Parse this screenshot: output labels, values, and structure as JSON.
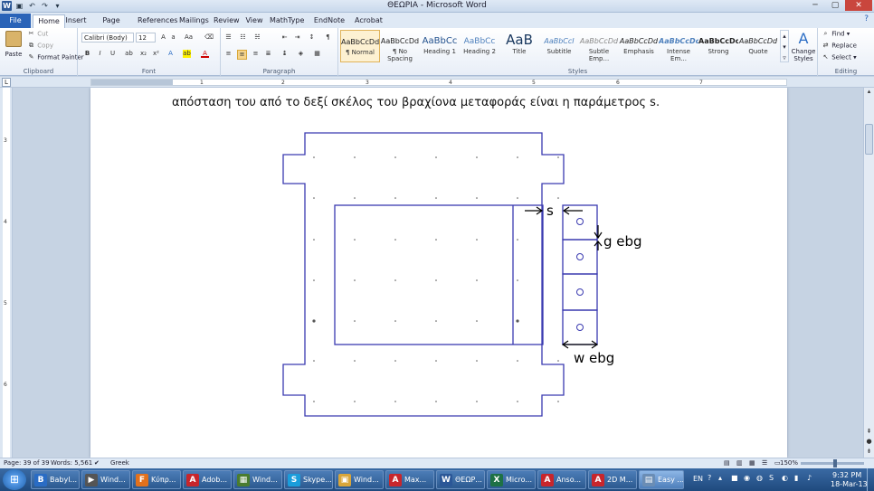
{
  "window": {
    "title": "ΘΕΩΡΙΑ - Microsoft Word",
    "minimize": "─",
    "maximize": "▢",
    "close": "✕"
  },
  "tabs": [
    "File",
    "Home",
    "Insert",
    "Page Layout",
    "References",
    "Mailings",
    "Review",
    "View",
    "MathType",
    "EndNote X5",
    "Acrobat"
  ],
  "ribbon": {
    "clipboard": {
      "paste": "Paste",
      "cut": "Cut",
      "copy": "Copy",
      "format_painter": "Format Painter",
      "label": "Clipboard"
    },
    "font": {
      "name": "Calibri (Body)",
      "size": "12",
      "label": "Font"
    },
    "paragraph": {
      "label": "Paragraph"
    },
    "styles": {
      "label": "Styles",
      "items": [
        {
          "sample": "AaBbCcDd",
          "name": "¶ Normal"
        },
        {
          "sample": "AaBbCcDd",
          "name": "¶ No Spacing"
        },
        {
          "sample": "AaBbCc",
          "name": "Heading 1"
        },
        {
          "sample": "AaBbCc",
          "name": "Heading 2"
        },
        {
          "sample": "AaB",
          "name": "Title"
        },
        {
          "sample": "AaBbCcI",
          "name": "Subtitle"
        },
        {
          "sample": "AaBbCcDd",
          "name": "Subtle Emp..."
        },
        {
          "sample": "AaBbCcDd",
          "name": "Emphasis"
        },
        {
          "sample": "AaBbCcDc",
          "name": "Intense Em..."
        },
        {
          "sample": "AaBbCcDc",
          "name": "Strong"
        },
        {
          "sample": "AaBbCcDd",
          "name": "Quote"
        }
      ],
      "change_styles": "Change Styles"
    },
    "editing": {
      "find": "Find",
      "replace": "Replace",
      "select": "Select",
      "label": "Editing"
    }
  },
  "ruler": {
    "numbers": [
      "1",
      "2",
      "3",
      "4",
      "5",
      "6",
      "7"
    ],
    "vnumbers": [
      "3",
      "4",
      "5",
      "6"
    ]
  },
  "document": {
    "text_line": "απόσταση του από το δεξί σκέλος του βραχίονα μεταφοράς είναι η παράμετρος s.",
    "diagram": {
      "label_s": "s",
      "label_g": "g ebg",
      "label_w": "w ebg"
    }
  },
  "statusbar": {
    "page": "Page: 39 of 39",
    "words": "Words: 5,561",
    "language": "Greek",
    "zoom": "150%"
  },
  "taskbar": {
    "items": [
      {
        "label": "Babyl...",
        "icon": "B",
        "color": "#2a6cc4"
      },
      {
        "label": "Wind...",
        "icon": "▶",
        "color": "#555"
      },
      {
        "label": "Κύπρ...",
        "icon": "F",
        "color": "#e2711d"
      },
      {
        "label": "Adob...",
        "icon": "A",
        "color": "#c8262c"
      },
      {
        "label": "Wind...",
        "icon": "▦",
        "color": "#4a7c2f"
      },
      {
        "label": "Skype...",
        "icon": "S",
        "color": "#1a9ddb"
      },
      {
        "label": "Wind...",
        "icon": "▣",
        "color": "#d9a63a"
      },
      {
        "label": "Max...",
        "icon": "A",
        "color": "#c8262c"
      },
      {
        "label": "ΘΕΩΡ...",
        "icon": "W",
        "color": "#2b5797"
      },
      {
        "label": "Micro...",
        "icon": "X",
        "color": "#1e7145"
      },
      {
        "label": "Anso...",
        "icon": "A",
        "color": "#c8262c"
      },
      {
        "label": "2D M...",
        "icon": "A",
        "color": "#c8262c"
      },
      {
        "label": "Easy ...",
        "icon": "▤",
        "color": "#6a8db5"
      }
    ],
    "tray": {
      "lang": "EN",
      "time": "9:32 PM",
      "date": "18-Mar-13"
    }
  }
}
